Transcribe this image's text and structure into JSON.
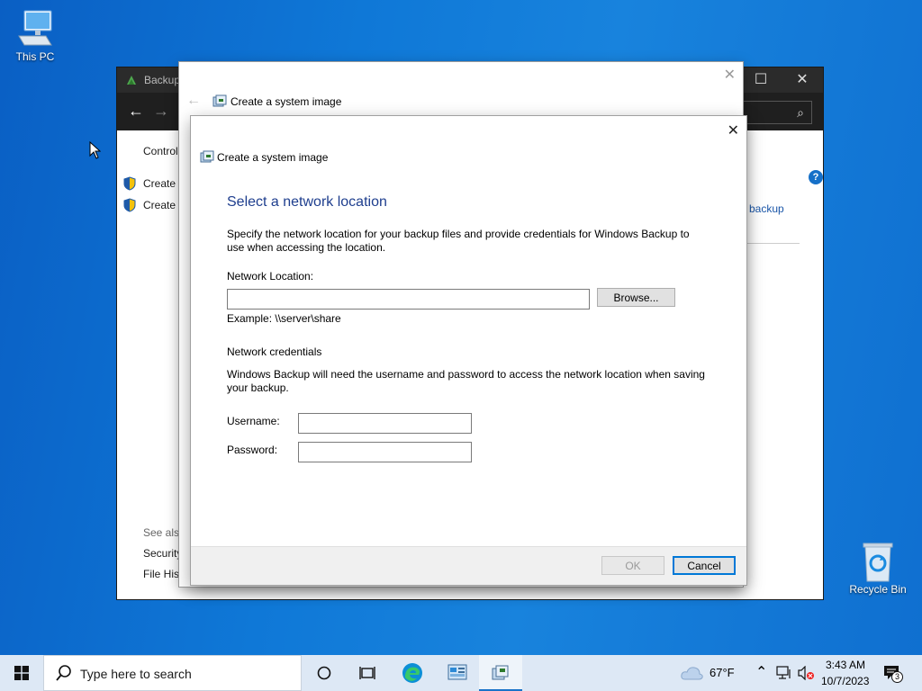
{
  "desktop": {
    "icons": [
      {
        "label": "This PC",
        "icon": "computer-icon"
      },
      {
        "label": "Recycle Bin",
        "icon": "recycle-bin-icon"
      }
    ]
  },
  "control_panel": {
    "title": "Backup",
    "nav_text": "Control",
    "tasks": [
      "Create a",
      "Create a"
    ],
    "right_link": "p backup",
    "see_also": "See also",
    "see_also_links": [
      "Security",
      "File Hist"
    ]
  },
  "wizard_bg": {
    "title": "Create a system image"
  },
  "dialog": {
    "title": "Create a system image",
    "heading": "Select a network location",
    "intro": "Specify the network location for your backup files and provide credentials for Windows Backup to use when accessing the location.",
    "network_location_label": "Network Location:",
    "network_location_value": "",
    "browse_label": "Browse...",
    "example": "Example: \\\\server\\share",
    "credentials_heading": "Network credentials",
    "credentials_text": "Windows Backup will need the username and password to access the network location when saving your backup.",
    "username_label": "Username:",
    "username_value": "",
    "password_label": "Password:",
    "password_value": "",
    "ok_label": "OK",
    "cancel_label": "Cancel"
  },
  "taskbar": {
    "search_placeholder": "Type here to search",
    "weather": "67°F",
    "time": "3:43 AM",
    "date": "10/7/2023",
    "notifications": "3"
  },
  "colors": {
    "heading": "#1e3e8e",
    "accent": "#0078d7",
    "taskbar": "#dde8f5"
  }
}
